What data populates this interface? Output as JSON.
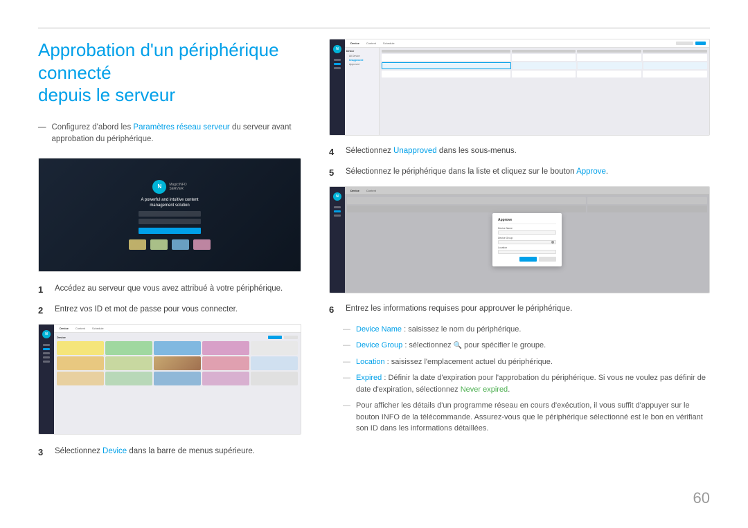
{
  "page": {
    "number": "60",
    "title_line1": "Approbation d'un périphérique connecté",
    "title_line2": "depuis le serveur"
  },
  "intro": {
    "prefix": "Configurez d'abord les ",
    "link_text": "Paramètres réseau serveur",
    "suffix": " du serveur avant approbation du périphérique."
  },
  "steps_left": [
    {
      "num": "1",
      "text": "Accédez au serveur que vous avez attribué à votre périphérique."
    },
    {
      "num": "2",
      "text": "Entrez vos ID et mot de passe pour vous connecter."
    },
    {
      "num": "3",
      "text": "Sélectionnez ",
      "link_text": "Device",
      "text_after": " dans la barre de menus supérieure."
    }
  ],
  "steps_right": [
    {
      "num": "4",
      "text": "Sélectionnez ",
      "link_text": "Unapproved",
      "text_after": " dans les sous-menus."
    },
    {
      "num": "5",
      "text": "Sélectionnez le périphérique dans la liste et cliquez sur le bouton ",
      "link_text": "Approve",
      "text_after": "."
    },
    {
      "num": "6",
      "text": "Entrez les informations requises pour approuver le périphérique."
    }
  ],
  "details": [
    {
      "label": "Device Name",
      "text": " : saisissez le nom du périphérique."
    },
    {
      "label": "Device Group",
      "text": " : sélectionnez ",
      "icon": "🔍",
      "text_after": " pour spécifier le groupe."
    },
    {
      "label": "Location",
      "text": " : saisissez l'emplacement actuel du périphérique."
    },
    {
      "label": "Expired",
      "text": " : Définir la date d'expiration pour l'approbation du périphérique. Si vous ne voulez pas définir de date d'expiration, sélectionnez ",
      "link_text": "Never expired",
      "text_after": "."
    },
    {
      "text": "Pour afficher les détails d'un programme réseau en cours d'exécution, il vous suffit d'appuyer sur le bouton INFO de la télécommande. Assurez-vous que le périphérique sélectionné est le bon en vérifiant son ID dans les informations détaillées."
    }
  ],
  "colors": {
    "blue_link": "#00a0e9",
    "green_link": "#4caf50",
    "title_blue": "#00a0e9"
  }
}
